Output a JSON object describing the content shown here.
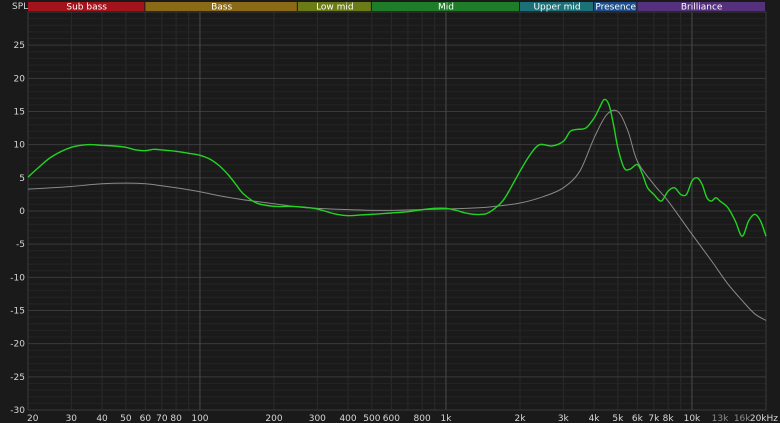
{
  "chart_data": {
    "type": "line",
    "ylabel": "SPL",
    "ylim": [
      -30,
      30
    ],
    "xlim": [
      20,
      20000
    ],
    "x_scale": "log",
    "grid": true,
    "bands": [
      {
        "name": "Sub bass",
        "from": 20,
        "to": 60,
        "color": "#a3131b"
      },
      {
        "name": "Bass",
        "from": 60,
        "to": 250,
        "color": "#8b6a17"
      },
      {
        "name": "Low mid",
        "from": 250,
        "to": 500,
        "color": "#6b7c17"
      },
      {
        "name": "Mid",
        "from": 500,
        "to": 2000,
        "color": "#1f7d2a"
      },
      {
        "name": "Upper mid",
        "from": 2000,
        "to": 4000,
        "color": "#1c7178"
      },
      {
        "name": "Presence",
        "from": 4000,
        "to": 6000,
        "color": "#1e4f8c"
      },
      {
        "name": "Brilliance",
        "from": 6000,
        "to": 20000,
        "color": "#55307c"
      }
    ],
    "y_ticks": [
      "25",
      "20",
      "15",
      "10",
      "5",
      "0",
      "-5",
      "-10",
      "-15",
      "-20",
      "-25",
      "-30"
    ],
    "x_ticks": [
      {
        "v": 20,
        "label": "20"
      },
      {
        "v": 30,
        "label": "30"
      },
      {
        "v": 40,
        "label": "40"
      },
      {
        "v": 50,
        "label": "50"
      },
      {
        "v": 60,
        "label": "60"
      },
      {
        "v": 70,
        "label": "70"
      },
      {
        "v": 80,
        "label": "80"
      },
      {
        "v": 100,
        "label": "100"
      },
      {
        "v": 200,
        "label": "200"
      },
      {
        "v": 300,
        "label": "300"
      },
      {
        "v": 400,
        "label": "400"
      },
      {
        "v": 500,
        "label": "500"
      },
      {
        "v": 600,
        "label": "600"
      },
      {
        "v": 800,
        "label": "800"
      },
      {
        "v": 1000,
        "label": "1k"
      },
      {
        "v": 2000,
        "label": "2k"
      },
      {
        "v": 3000,
        "label": "3k"
      },
      {
        "v": 4000,
        "label": "4k"
      },
      {
        "v": 5000,
        "label": "5k"
      },
      {
        "v": 6000,
        "label": "6k"
      },
      {
        "v": 7000,
        "label": "7k"
      },
      {
        "v": 8000,
        "label": "8k"
      },
      {
        "v": 10000,
        "label": "10k"
      },
      {
        "v": 13000,
        "label": "13k",
        "dim": true
      },
      {
        "v": 16000,
        "label": "16k",
        "dim": true
      },
      {
        "v": 20000,
        "label": "20kHz"
      }
    ],
    "series": [
      {
        "color": "#22d422",
        "x": [
          20,
          22,
          25,
          30,
          35,
          40,
          45,
          50,
          55,
          60,
          65,
          70,
          80,
          90,
          100,
          110,
          120,
          130,
          140,
          150,
          170,
          200,
          230,
          260,
          300,
          350,
          400,
          450,
          500,
          600,
          700,
          800,
          900,
          1000,
          1100,
          1200,
          1300,
          1400,
          1500,
          1700,
          1900,
          2000,
          2200,
          2400,
          2700,
          3000,
          3200,
          3400,
          3700,
          4000,
          4200,
          4400,
          4600,
          4800,
          5000,
          5300,
          5600,
          6000,
          6300,
          6600,
          7000,
          7500,
          8000,
          8500,
          9000,
          9500,
          10000,
          10500,
          11000,
          11500,
          12000,
          12500,
          13000,
          14000,
          15000,
          16000,
          17000,
          18000,
          19000,
          20000
        ],
        "y": [
          5.1,
          6.5,
          8.2,
          9.6,
          10.0,
          9.9,
          9.8,
          9.6,
          9.2,
          9.1,
          9.3,
          9.2,
          9.0,
          8.7,
          8.4,
          7.8,
          6.8,
          5.5,
          4.0,
          2.6,
          1.2,
          0.7,
          0.7,
          0.6,
          0.3,
          -0.4,
          -0.7,
          -0.6,
          -0.5,
          -0.3,
          -0.1,
          0.2,
          0.4,
          0.4,
          0.1,
          -0.3,
          -0.5,
          -0.5,
          -0.2,
          1.5,
          4.5,
          6.0,
          8.5,
          10.0,
          9.8,
          10.5,
          12.0,
          12.3,
          12.5,
          14.0,
          15.5,
          16.8,
          16.0,
          13.0,
          9.5,
          6.5,
          6.3,
          7.0,
          5.5,
          3.5,
          2.5,
          1.5,
          3.0,
          3.5,
          2.5,
          2.5,
          4.5,
          5.0,
          4.0,
          2.0,
          1.5,
          2.0,
          1.5,
          0.5,
          -1.5,
          -3.8,
          -1.5,
          -0.5,
          -1.5,
          -3.8
        ]
      },
      {
        "color": "#8a8a8a",
        "x": [
          20,
          25,
          30,
          40,
          50,
          60,
          70,
          80,
          100,
          120,
          150,
          200,
          250,
          300,
          400,
          500,
          600,
          800,
          1000,
          1200,
          1500,
          2000,
          2500,
          3000,
          3500,
          4000,
          4500,
          5000,
          5500,
          6000,
          7000,
          8000,
          10000,
          12000,
          14000,
          16000,
          18000,
          20000
        ],
        "y": [
          3.3,
          3.5,
          3.7,
          4.1,
          4.2,
          4.1,
          3.8,
          3.5,
          2.9,
          2.3,
          1.7,
          1.1,
          0.6,
          0.4,
          0.2,
          0.1,
          0.1,
          0.2,
          0.3,
          0.4,
          0.6,
          1.2,
          2.2,
          3.5,
          6.0,
          11.0,
          14.5,
          15.0,
          12.0,
          7.5,
          4.0,
          1.5,
          -3.5,
          -7.5,
          -11.0,
          -13.5,
          -15.5,
          -16.5
        ]
      }
    ]
  }
}
